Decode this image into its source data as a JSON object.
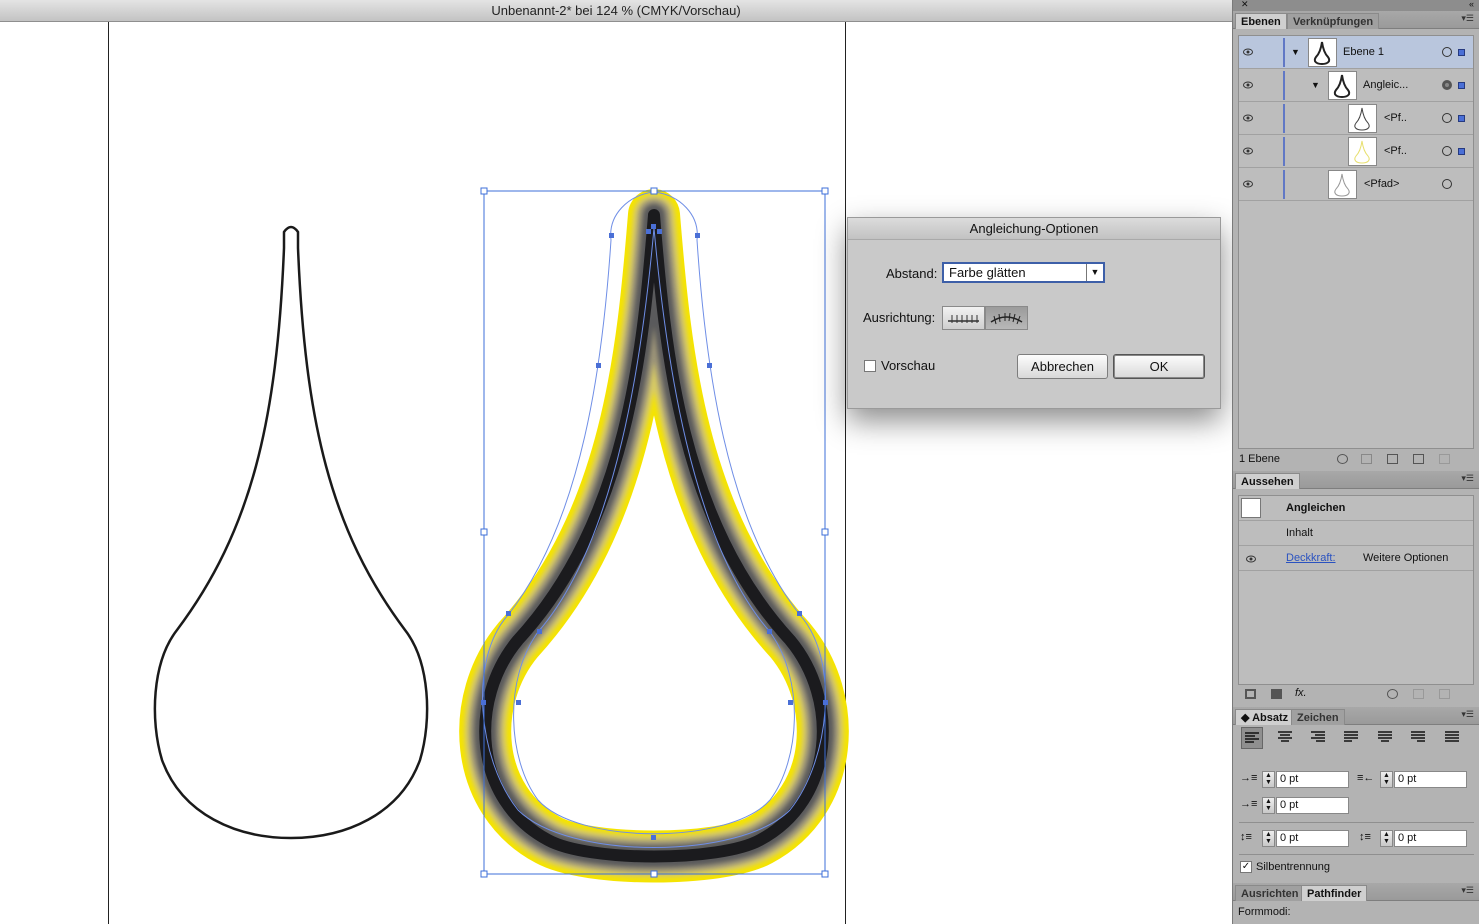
{
  "window": {
    "title": "Unbenannt-2* bei 124 % (CMYK/Vorschau)"
  },
  "dialog": {
    "title": "Angleichung-Optionen",
    "abstand_label": "Abstand:",
    "abstand_value": "Farbe glätten",
    "ausrichtung_label": "Ausrichtung:",
    "preview_label": "Vorschau",
    "preview_checked": false,
    "cancel_label": "Abbrechen",
    "ok_label": "OK"
  },
  "layers_panel": {
    "tabs": [
      "Ebenen",
      "Verknüpfungen"
    ],
    "rows": [
      {
        "name": "Ebene 1",
        "selected": true
      },
      {
        "name": "Angleic..."
      },
      {
        "name": "<Pf.."
      },
      {
        "name": "<Pf.."
      },
      {
        "name": "<Pfad>"
      }
    ],
    "footer": "1 Ebene"
  },
  "appearance_panel": {
    "tab": "Aussehen",
    "title_row": "Angleichen",
    "content_row": "Inhalt",
    "opacity_link": "Deckkraft:",
    "opacity_value": "Weitere Optionen"
  },
  "paragraph_panel": {
    "tabs": [
      "Absatz",
      "Zeichen"
    ],
    "fields": {
      "left_indent": "0 pt",
      "right_indent": "0 pt",
      "first_line": "0 pt",
      "space_before": "0 pt",
      "space_after": "0 pt"
    },
    "hyphenation_label": "Silbentrennung",
    "hyphenation_checked": true
  },
  "bottom_panel": {
    "tabs": [
      "Ausrichten",
      "Pathfinder"
    ],
    "shape_modes_label": "Formmodi:"
  },
  "colors": {
    "accent_blue": "#4a6fd6",
    "blend_yellow": "#f5e400",
    "selection_blue": "#3d6fd8"
  }
}
